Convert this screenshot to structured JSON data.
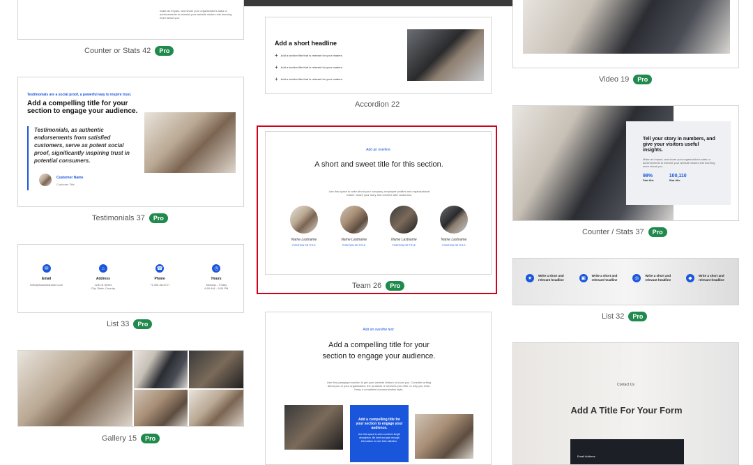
{
  "cards": {
    "counter42": {
      "title": "Counter or Stats 42",
      "pro": "Pro",
      "snippet": "make an impact, and share your organization's stats or achievements to interest your website visitors into learning more about you."
    },
    "testimonials37": {
      "title": "Testimonials 37",
      "pro": "Pro",
      "overline": "Testimonials are a social proof, a powerful way to inspire trust.",
      "heading": "Add a compelling title for your section to engage your audience.",
      "quote": "Testimonials, as authentic endorsements from satisfied customers, serve as potent social proof, significantly inspiring trust in potential consumers.",
      "customer_name": "Customer Name",
      "customer_title": "Customer Title"
    },
    "list33": {
      "title": "List 33",
      "pro": "Pro",
      "items": [
        {
          "label": "Email",
          "value": "hello@businessname.com",
          "value2": "",
          "icon": "mail-icon"
        },
        {
          "label": "Address",
          "value": "1234 N Street",
          "value2": "City, State, Country",
          "icon": "map-icon"
        },
        {
          "label": "Phone",
          "value": "+1 000-48-9717",
          "value2": "",
          "icon": "phone-icon"
        },
        {
          "label": "Hours",
          "value": "Monday – Friday",
          "value2": "8:00 AM – 5:00 PM",
          "icon": "clock-icon"
        }
      ]
    },
    "gallery15": {
      "title": "Gallery 15",
      "pro": "Pro"
    },
    "accordion22": {
      "title": "Accordion 22",
      "heading": "Add a short headline",
      "rows": [
        "Add a section title that is relevant for your readers.",
        "Add a section title that is relevant for your readers.",
        "Add a section title that is relevant for your readers."
      ]
    },
    "team26": {
      "title": "Team 26",
      "pro": "Pro",
      "overline": "Add an overline",
      "heading": "A short and sweet title for this section.",
      "body": "Use this space to write about your company, employee profiles and organizational culture; share your story and connect with customers.",
      "members": [
        {
          "name": "Name Lastname",
          "position": "POSITION OR TITLE"
        },
        {
          "name": "Name Lastname",
          "position": "POSITION OR TITLE"
        },
        {
          "name": "Name Lastname",
          "position": "POSITION OR TITLE"
        },
        {
          "name": "Name Lastname",
          "position": "POSITION OR TITLE"
        }
      ]
    },
    "compelling": {
      "overline": "Add an overline text",
      "heading": "Add a compelling title for your section to engage your audience.",
      "body": "Use this paragraph section to get your website visitors to know you. Consider writing about you or your organization, the products or services you offer, or why you exist. Keep a consistent communication style.",
      "box_title": "Add a compelling title for your section to engage your audience.",
      "box_body": "Use this space to add a medium length description. Be brief and give enough information to earn their attention."
    },
    "video19": {
      "title": "Video 19",
      "pro": "Pro"
    },
    "counter37": {
      "title": "Counter / Stats 37",
      "pro": "Pro",
      "heading": "Tell your story in numbers, and give your visitors useful insights.",
      "body": "Make an impact, and share your organization's stats or achievements to interest your website visitors into learning more about you.",
      "stats": [
        {
          "value": "98%",
          "label": "Stat title"
        },
        {
          "value": "100,110",
          "label": "Stat title"
        }
      ]
    },
    "list32": {
      "title": "List 32",
      "pro": "Pro",
      "items": [
        "Write a short and relevant headline",
        "Write a short and relevant headline",
        "Write a short and relevant headline",
        "Write a short and relevant headline"
      ]
    },
    "contact": {
      "overline": "Contact Us",
      "heading": "Add A Title For Your Form",
      "field": "Email Address"
    }
  }
}
